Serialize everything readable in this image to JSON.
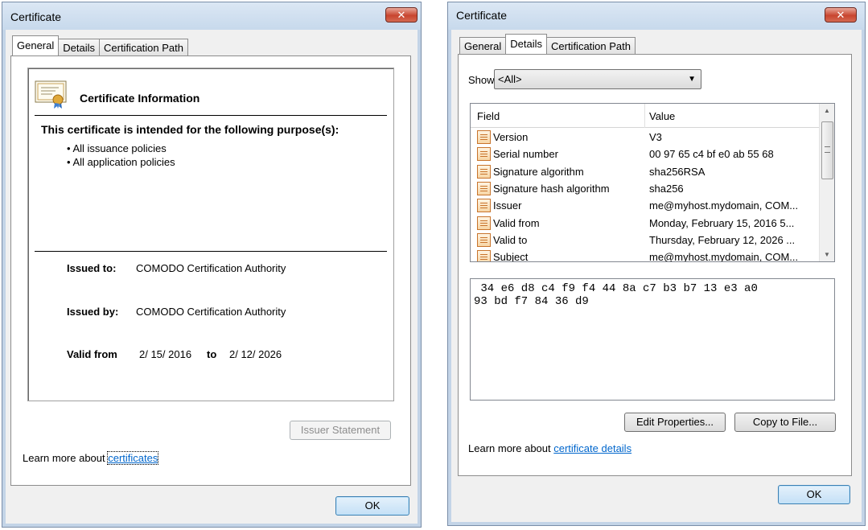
{
  "general_dialog": {
    "title": "Certificate",
    "close_label": "✕",
    "tabs": [
      "General",
      "Details",
      "Certification Path"
    ],
    "cert_info_title": "Certificate Information",
    "purpose_heading": "This certificate is intended for the following purpose(s):",
    "policies": [
      "• All issuance policies",
      "• All application policies"
    ],
    "issued_to_label": "Issued to:",
    "issued_to_value": "COMODO Certification Authority",
    "issued_by_label": "Issued by:",
    "issued_by_value": "COMODO Certification Authority",
    "valid_from_label": "Valid from",
    "valid_from_value": "2/ 15/ 2016",
    "valid_to_label": "to",
    "valid_to_value": "2/ 12/ 2026",
    "issuer_statement_label": "Issuer Statement",
    "learn_more_text": "Learn more about",
    "learn_more_link": "certificates",
    "ok_label": "OK"
  },
  "details_dialog": {
    "title": "Certificate",
    "close_label": "✕",
    "tabs": [
      "General",
      "Details",
      "Certification Path"
    ],
    "show_label": "Show:",
    "show_value": "<All>",
    "columns": [
      "Field",
      "Value"
    ],
    "rows": [
      {
        "field": "Version",
        "value": "V3"
      },
      {
        "field": "Serial number",
        "value": "00 97 65 c4 bf e0 ab 55 68"
      },
      {
        "field": "Signature algorithm",
        "value": "sha256RSA"
      },
      {
        "field": "Signature hash algorithm",
        "value": "sha256"
      },
      {
        "field": "Issuer",
        "value": "me@myhost.mydomain, COM..."
      },
      {
        "field": "Valid from",
        "value": "Monday, February 15, 2016 5..."
      },
      {
        "field": "Valid to",
        "value": "Thursday, February 12, 2026 ..."
      },
      {
        "field": "Subject",
        "value": "me@myhost.mydomain, COM..."
      }
    ],
    "hex_lines": " 34 e6 d8 c4 f9 f4 44 8a c7 b3 b7 13 e3 a0\n93 bd f7 84 36 d9",
    "edit_properties_label": "Edit Properties...",
    "copy_to_file_label": "Copy to File...",
    "learn_more_text": "Learn more about",
    "learn_more_link": "certificate details",
    "ok_label": "OK"
  },
  "colors": {
    "frame": "#c6d7ea",
    "client": "#f0f0f0",
    "link": "#0066cc",
    "close_button": "#c8452f",
    "default_button_border": "#3c7fb1"
  }
}
